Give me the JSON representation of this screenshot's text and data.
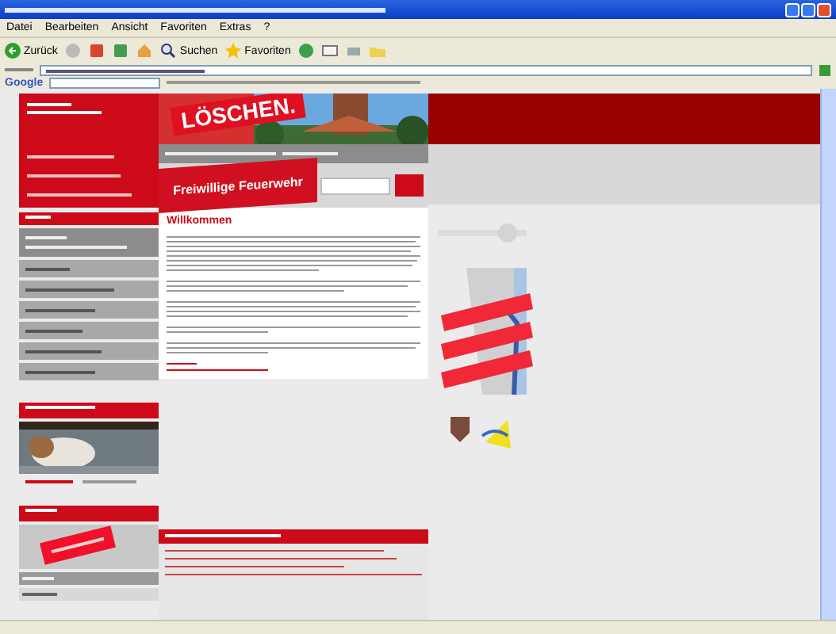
{
  "browser": {
    "menu": [
      "Datei",
      "Bearbeiten",
      "Ansicht",
      "Favoriten",
      "Extras",
      "?"
    ],
    "toolbar": [
      {
        "kind": "back",
        "label": "Zurück"
      },
      {
        "kind": "search",
        "label": "Suchen"
      },
      {
        "kind": "favorites",
        "label": "Favoriten"
      }
    ],
    "search_toolbar": {
      "label": "Google"
    }
  },
  "page": {
    "banner": {
      "slogan": "LÖSCHEN."
    },
    "tagline": "Freiwillige Feuerwehr",
    "content": {
      "heading": "Willkommen"
    }
  }
}
